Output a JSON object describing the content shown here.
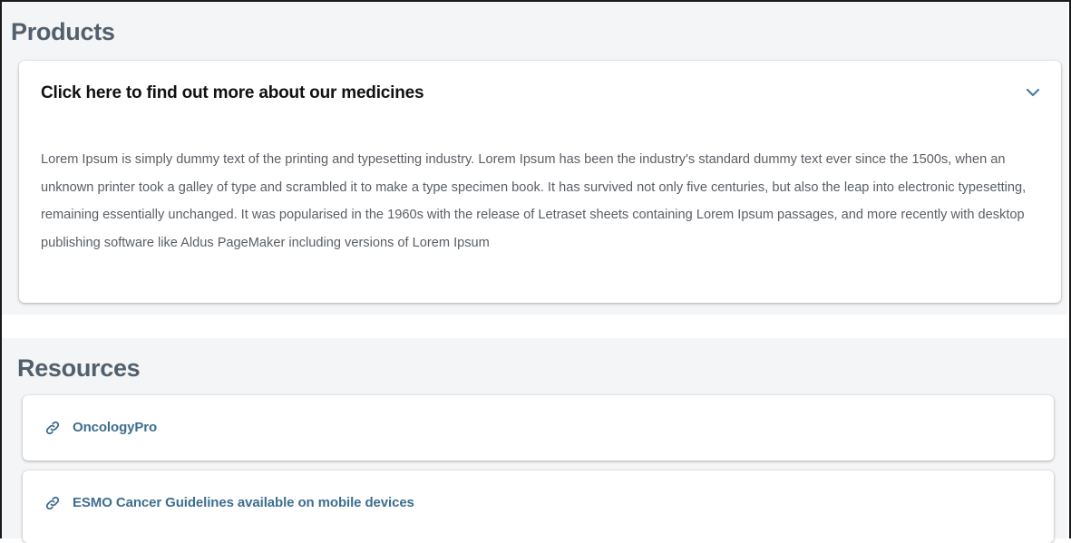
{
  "products": {
    "title": "Products",
    "accordion": {
      "title": "Click here to find out more about our medicines",
      "expanded": true,
      "body": "Lorem Ipsum is simply dummy text of the printing and typesetting industry. Lorem Ipsum has been the industry's standard dummy text ever since the 1500s, when an unknown printer took a galley of type and scrambled it to make a type specimen book. It has survived not only five centuries, but also the leap into electronic typesetting, remaining essentially unchanged. It was popularised in the 1960s with the release of Letraset sheets containing Lorem Ipsum passages, and more recently with desktop publishing software like Aldus PageMaker including versions of Lorem Ipsum",
      "icon": "chevron-down-icon"
    }
  },
  "resources": {
    "title": "Resources",
    "links": [
      {
        "label": "OncologyPro",
        "icon": "link-icon"
      },
      {
        "label": "ESMO Cancer Guidelines available on mobile devices",
        "icon": "link-icon"
      }
    ]
  },
  "colors": {
    "section_background": "#f4f5f6",
    "section_heading": "#51606c",
    "accordion_title": "#111111",
    "body_text": "#5a5f65",
    "link": "#3d6e8f",
    "chevron": "#4a7e9e"
  }
}
